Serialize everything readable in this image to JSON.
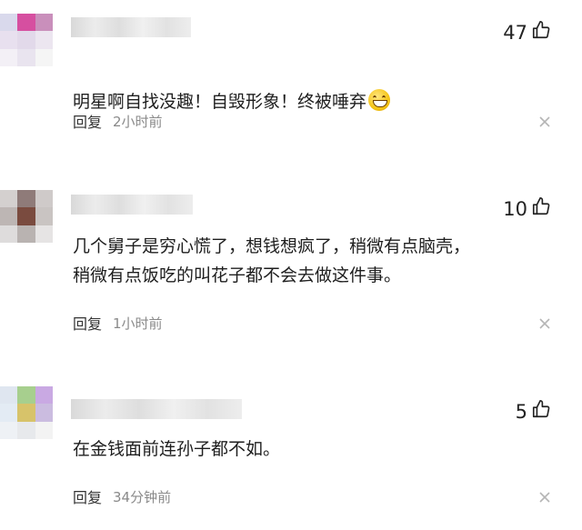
{
  "comments": [
    {
      "likes": "47",
      "text": "明星啊自找没趣！自毁形象！终被唾弃",
      "has_emoji": true,
      "reply_label": "回复",
      "time": "2小时前",
      "avatar_colors": [
        "#d9d9ec",
        "#d64fa0",
        "#c98fbb",
        "#e8e0ef",
        "#e2d9ea",
        "#ece6f0",
        "#f3f0f6",
        "#e9e4ef",
        "#f5f5f5"
      ]
    },
    {
      "likes": "10",
      "text": "几个舅子是穷心慌了，想钱想疯了，稍微有点脑壳，\n稍微有点饭吃的叫花子都不会去做这件事。",
      "has_emoji": false,
      "reply_label": "回复",
      "time": "1小时前",
      "avatar_colors": [
        "#d4d0cf",
        "#8f7b79",
        "#cfcac9",
        "#bdb6b4",
        "#7a4b3f",
        "#c9c4c2",
        "#dedcdc",
        "#b9b3b1",
        "#e6e4e4"
      ]
    },
    {
      "likes": "5",
      "text": "在金钱面前连孙子都不如。",
      "has_emoji": false,
      "reply_label": "回复",
      "time": "34分钟前",
      "avatar_colors": [
        "#dfe6f0",
        "#a7cf8e",
        "#c9a9e3",
        "#e3ebf4",
        "#d7c36a",
        "#cbbce0",
        "#eef1f5",
        "#e7e9ec",
        "#f3f3f3"
      ]
    }
  ],
  "icons": {
    "like": "thumbs-up-icon",
    "close": "close-icon"
  }
}
